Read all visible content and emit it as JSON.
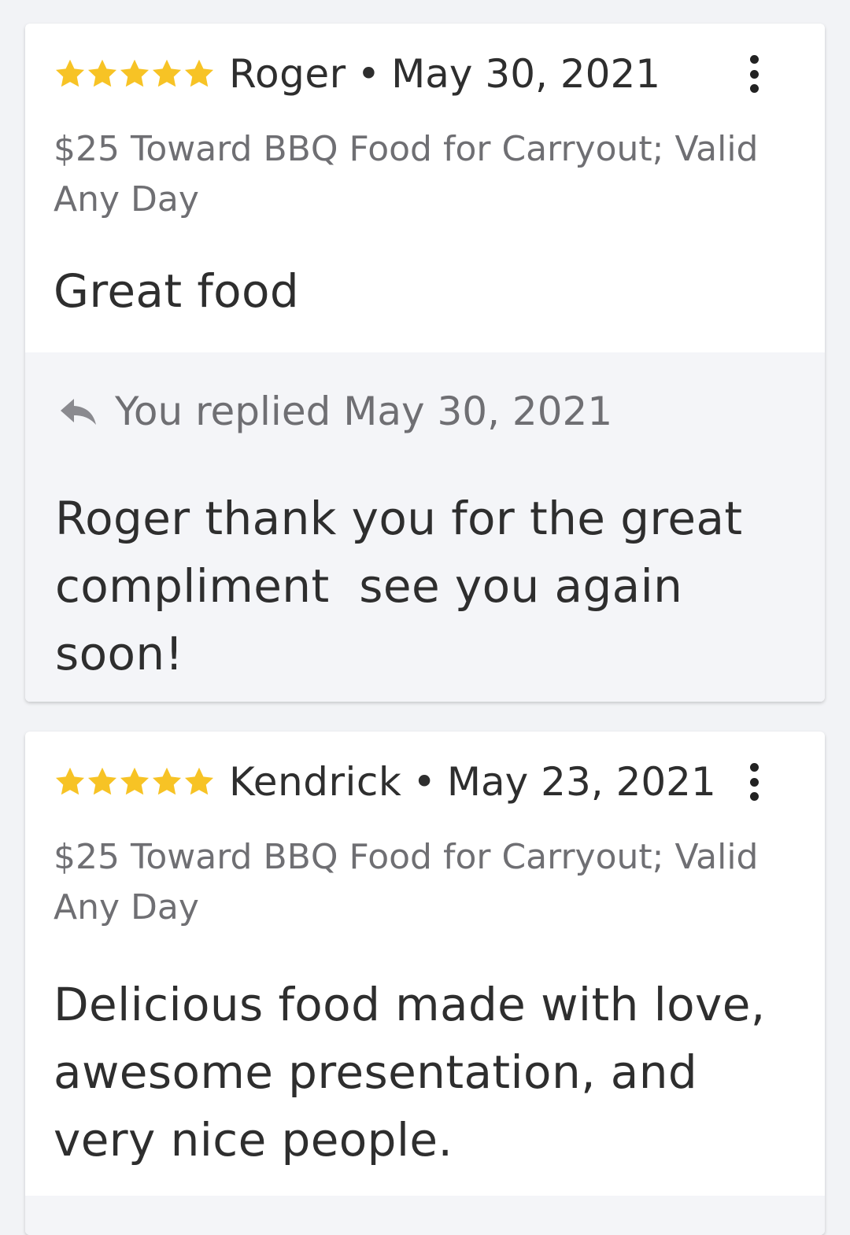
{
  "reviews": [
    {
      "rating": 5,
      "reviewer": "Roger",
      "separator": "•",
      "date": "May 30, 2021",
      "deal": "$25 Toward BBQ Food for Carryout; Valid Any Day",
      "text": "Great food",
      "reply": {
        "label": "You replied May 30, 2021",
        "text": "Roger thank you for the great compliment  see you again soon!"
      }
    },
    {
      "rating": 5,
      "reviewer": "Kendrick",
      "separator": "•",
      "date": "May 23, 2021",
      "deal": "$25 Toward BBQ Food for Carryout; Valid Any Day",
      "text": "Delicious food made with love, awesome presentation, and very nice people."
    }
  ],
  "icons": {
    "star": "star-icon",
    "more": "more-vertical-icon",
    "reply": "reply-arrow-icon"
  },
  "colors": {
    "star": "#f7c325",
    "background": "#f2f3f6",
    "card": "#ffffff",
    "reply_background": "#f4f5f8",
    "primary_text": "#2e2e2e",
    "secondary_text": "#6f6f73"
  }
}
